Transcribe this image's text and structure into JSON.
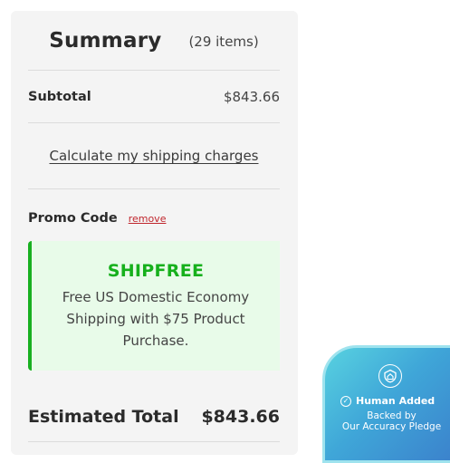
{
  "summary": {
    "title": "Summary",
    "item_count": "(29 items)",
    "subtotal_label": "Subtotal",
    "subtotal_value": "$843.66",
    "shipping_link": "Calculate my shipping charges",
    "promo_label": "Promo Code",
    "promo_remove": "remove",
    "promo": {
      "code": "SHIPFREE",
      "description": "Free US Domestic Economy Shipping with $75 Product Purchase.",
      "accent_color": "#16b01c",
      "background_color": "#e8fbe9"
    },
    "total_label": "Estimated Total",
    "total_value": "$843.66"
  },
  "badge": {
    "icon": "shield-home-icon",
    "check_icon": "check-circle-icon",
    "line1": "Human Added",
    "line2a": "Backed by",
    "line2b": "Our Accuracy Pledge"
  }
}
